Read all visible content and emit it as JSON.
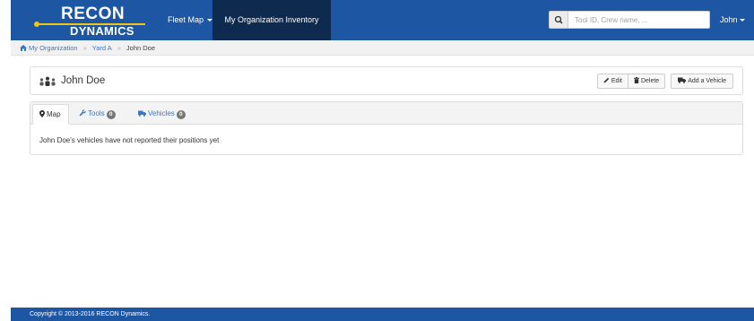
{
  "brand": {
    "top": "RECON",
    "bottom": "DYNAMICS"
  },
  "nav": {
    "fleet_map": "Fleet Map",
    "inventory": "My Organization Inventory",
    "search_placeholder": "Tool ID, Crew name, ...",
    "user": "John"
  },
  "breadcrumb": {
    "items": [
      "My Organization",
      "Yard A"
    ],
    "current": "John Doe"
  },
  "person": {
    "name": "John Doe",
    "buttons": {
      "edit": "Edit",
      "delete": "Delete",
      "add_vehicle": "Add a Vehicle"
    }
  },
  "tabs": [
    {
      "label": "Map"
    },
    {
      "label": "Tools",
      "count": "0"
    },
    {
      "label": "Vehicles",
      "count": "0"
    }
  ],
  "tab_message": "John Doe's vehicles have not reported their positions yet",
  "footer": "Copyright © 2013-2016 RECON Dynamics.",
  "colors": {
    "navbar": "#1d57a3",
    "nav_active": "#0e2a4f",
    "link": "#3b78c3",
    "accent": "#f0c419"
  }
}
